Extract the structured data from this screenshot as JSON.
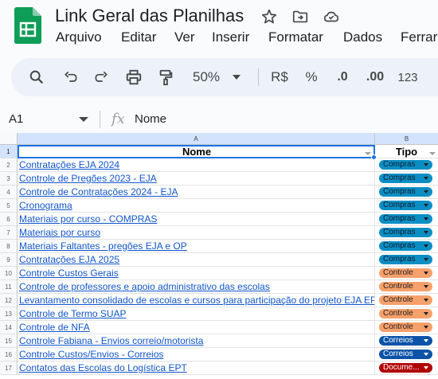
{
  "document": {
    "title": "Link Geral das Planilhas"
  },
  "menu": [
    "Arquivo",
    "Editar",
    "Ver",
    "Inserir",
    "Formatar",
    "Dados",
    "Ferrar"
  ],
  "toolbar": {
    "zoom": "50%",
    "currency": "R$",
    "percent": "%",
    "dec_decrease": ".0",
    "dec_increase": ".00",
    "number_format": "123"
  },
  "formula_bar": {
    "cell_ref": "A1",
    "fx": "fx",
    "value": "Nome"
  },
  "grid": {
    "columns": [
      "A",
      "B"
    ],
    "headers": {
      "name": "Nome",
      "type": "Tipo"
    },
    "rows": [
      {
        "n": "1"
      },
      {
        "n": "2",
        "name": "Contratações EJA 2024",
        "type": "Compras"
      },
      {
        "n": "3",
        "name": "Controle de Pregões 2023 - EJA",
        "type": "Compras"
      },
      {
        "n": "4",
        "name": "Controle de Contratações 2024 - EJA",
        "type": "Compras"
      },
      {
        "n": "5",
        "name": "Cronograma",
        "type": "Compras"
      },
      {
        "n": "6",
        "name": "Materiais por curso - COMPRAS",
        "type": "Compras"
      },
      {
        "n": "7",
        "name": "Materiais por curso",
        "type": "Compras"
      },
      {
        "n": "8",
        "name": "Materiais Faltantes - pregões EJA e OP",
        "type": "Compras"
      },
      {
        "n": "9",
        "name": "Contratações EJA 2025",
        "type": "Compras"
      },
      {
        "n": "10",
        "name": "Controle Custos Gerais",
        "type": "Controle"
      },
      {
        "n": "11",
        "name": "Controle de professores e apoio administrativo das escolas",
        "type": "Controle"
      },
      {
        "n": "12",
        "name": "Levantamento consolidado de escolas e cursos para participação do projeto EJA EPT",
        "type": "Controle"
      },
      {
        "n": "13",
        "name": "Controle de Termo SUAP",
        "type": "Controle"
      },
      {
        "n": "14",
        "name": "Controle de NFA",
        "type": "Controle"
      },
      {
        "n": "15",
        "name": "Controle Fabiana - Envios correio/motorista",
        "type": "Correios"
      },
      {
        "n": "16",
        "name": "Controle Custos/Envios - Correios",
        "type": "Correios"
      },
      {
        "n": "17",
        "name": "Contatos das Escolas do Logística EPT",
        "type": "Docume..."
      }
    ]
  },
  "colors": {
    "compras": "#0b8ec4",
    "controle": "#f6a06b",
    "correios": "#0a53a8",
    "documento": "#b10202",
    "selection": "#1a73e8"
  }
}
